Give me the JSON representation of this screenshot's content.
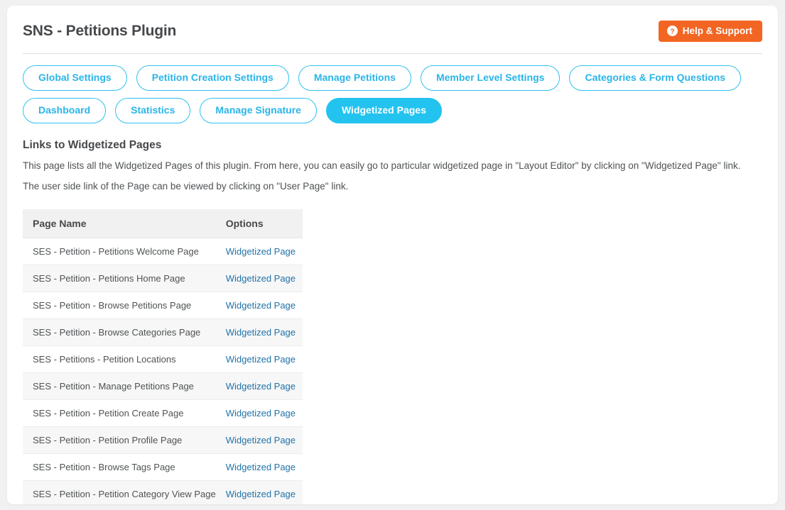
{
  "header": {
    "title": "SNS - Petitions Plugin",
    "help_button_label": "Help & Support",
    "help_icon": "question-circle-icon",
    "accent_color": "#22c3ef",
    "help_color": "#f26522"
  },
  "tabs": [
    {
      "label": "Global Settings",
      "active": false
    },
    {
      "label": "Petition Creation Settings",
      "active": false
    },
    {
      "label": "Manage Petitions",
      "active": false
    },
    {
      "label": "Member Level Settings",
      "active": false
    },
    {
      "label": "Categories & Form Questions",
      "active": false
    },
    {
      "label": "Dashboard",
      "active": false
    },
    {
      "label": "Statistics",
      "active": false
    },
    {
      "label": "Manage Signature",
      "active": false
    },
    {
      "label": "Widgetized Pages",
      "active": true
    }
  ],
  "section": {
    "title": "Links to Widgetized Pages",
    "description_line_1": "This page lists all the Widgetized Pages of this plugin. From here, you can easily go to particular widgetized page in \"Layout Editor\" by clicking on \"Widgetized Page\" link.",
    "description_line_2": "The user side link of the Page can be viewed by clicking on \"User Page\" link."
  },
  "table": {
    "columns": [
      "Page Name",
      "Options"
    ],
    "rows": [
      {
        "page_name": "SES - Petition - Petitions Welcome Page",
        "option_label": "Widgetized Page"
      },
      {
        "page_name": "SES - Petition - Petitions Home Page",
        "option_label": "Widgetized Page"
      },
      {
        "page_name": "SES - Petition - Browse Petitions Page",
        "option_label": "Widgetized Page"
      },
      {
        "page_name": "SES - Petition - Browse Categories Page",
        "option_label": "Widgetized Page"
      },
      {
        "page_name": "SES - Petitions - Petition Locations",
        "option_label": "Widgetized Page"
      },
      {
        "page_name": "SES - Petition - Manage Petitions Page",
        "option_label": "Widgetized Page"
      },
      {
        "page_name": "SES - Petition - Petition Create Page",
        "option_label": "Widgetized Page"
      },
      {
        "page_name": "SES - Petition - Petition Profile Page",
        "option_label": "Widgetized Page"
      },
      {
        "page_name": "SES - Petition - Browse Tags Page",
        "option_label": "Widgetized Page"
      },
      {
        "page_name": "SES - Petition - Petition Category View Page",
        "option_label": "Widgetized Page"
      }
    ]
  }
}
